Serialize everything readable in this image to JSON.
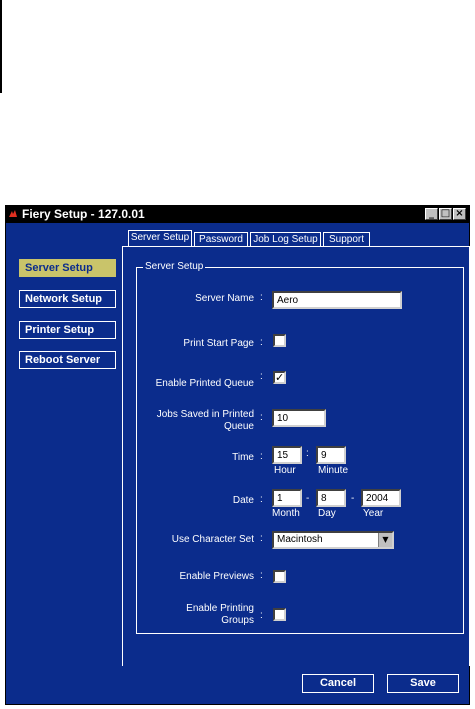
{
  "window": {
    "title": "Fiery Setup - 127.0.01",
    "minimize": "_",
    "maximize": "□",
    "close": "×"
  },
  "sidebar": {
    "items": [
      {
        "label": "Server Setup",
        "active": true
      },
      {
        "label": "Network Setup"
      },
      {
        "label": "Printer Setup"
      },
      {
        "label": "Reboot Server"
      }
    ]
  },
  "tabs": [
    {
      "label": "Server Setup",
      "active": true
    },
    {
      "label": "Password"
    },
    {
      "label": "Job Log Setup"
    },
    {
      "label": "Support"
    }
  ],
  "group": {
    "title": "Server Setup"
  },
  "form": {
    "colon": ":",
    "server_name": {
      "label": "Server Name",
      "value": "Aero"
    },
    "print_start_page": {
      "label": "Print Start Page",
      "checked": false
    },
    "enable_printed_queue": {
      "label": "Enable Printed Queue",
      "checked": true
    },
    "jobs_saved": {
      "label_line1": "Jobs Saved in Printed",
      "label_line2": "Queue",
      "value": "10"
    },
    "time": {
      "label": "Time",
      "hour": "15",
      "minute": "9",
      "hour_label": "Hour",
      "minute_label": "Minute",
      "sep": ":"
    },
    "date": {
      "label": "Date",
      "month": "1",
      "day": "8",
      "year": "2004",
      "month_label": "Month",
      "day_label": "Day",
      "year_label": "Year",
      "sep": "-"
    },
    "character_set": {
      "label": "Use Character Set",
      "value": "Macintosh"
    },
    "enable_previews": {
      "label": "Enable Previews",
      "checked": false
    },
    "enable_printing_groups": {
      "label_line1": "Enable Printing",
      "label_line2": "Groups",
      "checked": false
    }
  },
  "buttons": {
    "cancel": "Cancel",
    "save": "Save"
  },
  "check_mark": "✓",
  "dropdown_arrow": "▼",
  "colors": {
    "window_bg": "#0b2c8c",
    "active_nav": "#c9c46a",
    "title_bar": "#000000"
  }
}
